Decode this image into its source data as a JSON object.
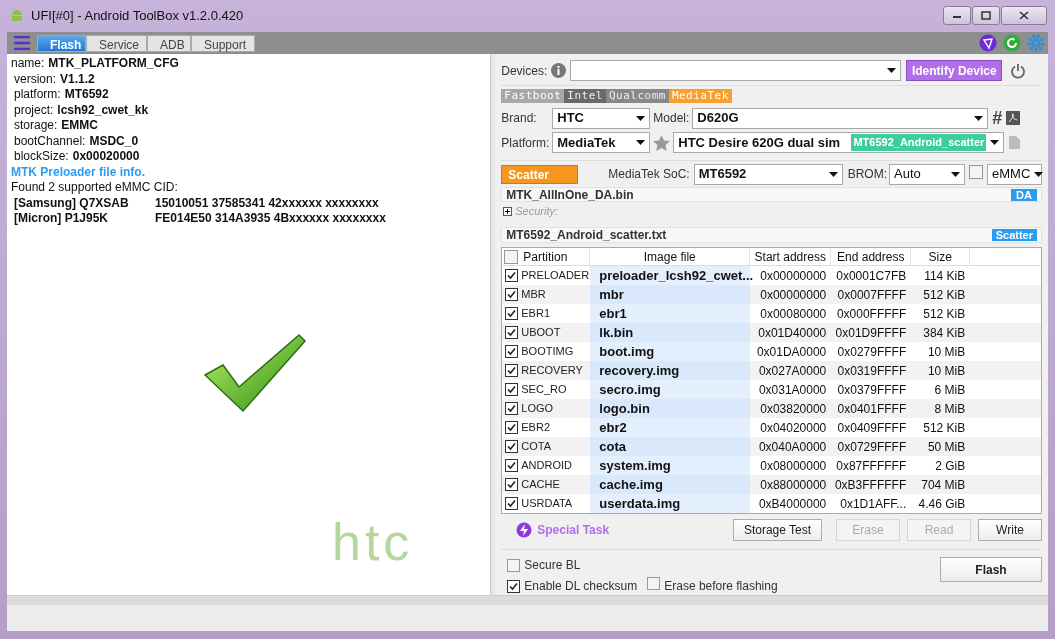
{
  "window": {
    "title": "UFI[#0] - Android ToolBox v1.2.0.420"
  },
  "tabs": [
    {
      "label": "Flash",
      "selected": true
    },
    {
      "label": "Service",
      "selected": false
    },
    {
      "label": "ADB",
      "selected": false
    },
    {
      "label": "Support",
      "selected": false
    }
  ],
  "log": [
    {
      "kind": "field",
      "label": "name:",
      "value": "MTK_PLATFORM_CFG"
    },
    {
      "kind": "subfield",
      "label": "version:",
      "value": "V1.1.2"
    },
    {
      "kind": "subfield",
      "label": "platform:",
      "value": "MT6592"
    },
    {
      "kind": "subfield",
      "label": "project:",
      "value": "lcsh92_cwet_kk"
    },
    {
      "kind": "subfield",
      "label": "storage:",
      "value": "EMMC"
    },
    {
      "kind": "subfield",
      "label": "bootChannel:",
      "value": "MSDC_0"
    },
    {
      "kind": "subfield",
      "label": "blockSize:",
      "value": "0x00020000"
    },
    {
      "kind": "heading",
      "text": "MTK Preloader file info."
    },
    {
      "kind": "plain",
      "text": "Found 2 supported eMMC CID:"
    },
    {
      "kind": "cid",
      "label": "[Samsung] Q7XSAB",
      "value": "15010051 37585341 42xxxxxx xxxxxxxx"
    },
    {
      "kind": "cid",
      "label": "[Micron] P1J95K",
      "value": "FE014E50 314A3935 4Bxxxxxx xxxxxxxx"
    }
  ],
  "brand_logo": "htc",
  "devices": {
    "label": "Devices:",
    "identify_button": "Identify Device"
  },
  "platform_tabs": [
    {
      "label": "Fastboot",
      "selected": false
    },
    {
      "label": "Intel",
      "selected": false
    },
    {
      "label": "Qualcomm",
      "selected": false
    },
    {
      "label": "MediaTek",
      "selected": true
    }
  ],
  "brand": {
    "label": "Brand:",
    "value": "HTC"
  },
  "model": {
    "label": "Model:",
    "value": "D620G",
    "hash_button": "#"
  },
  "platform": {
    "label": "Platform:",
    "value": "MediaTek"
  },
  "device_select": {
    "value": "HTC Desire 620G dual sim",
    "tag": "MT6592_Android_scatter"
  },
  "scatter_button": "Scatter",
  "soc": {
    "label": "MediaTek SoC:",
    "value": "MT6592"
  },
  "brom": {
    "label": "BROM:",
    "value": "Auto",
    "checked": false
  },
  "storage": {
    "value": "eMMC"
  },
  "da_file": {
    "name": "MTK_AllInOne_DA.bin",
    "badge": "DA"
  },
  "security": {
    "label": "Security:",
    "expanded": false
  },
  "scatter_file": {
    "name": "MT6592_Android_scatter.txt",
    "badge": "Scatter"
  },
  "table": {
    "all_checked": false,
    "columns": [
      "Partition",
      "Image file",
      "Start address",
      "End address",
      "Size"
    ],
    "rows": [
      {
        "checked": true,
        "partition": "PRELOADER",
        "file": "preloader_lcsh92_cwet...",
        "start": "0x00000000",
        "end": "0x0001C7FB",
        "size": "114 KiB"
      },
      {
        "checked": true,
        "partition": "MBR",
        "file": "mbr",
        "start": "0x00000000",
        "end": "0x0007FFFF",
        "size": "512 KiB"
      },
      {
        "checked": true,
        "partition": "EBR1",
        "file": "ebr1",
        "start": "0x00080000",
        "end": "0x000FFFFF",
        "size": "512 KiB"
      },
      {
        "checked": true,
        "partition": "UBOOT",
        "file": "lk.bin",
        "start": "0x01D40000",
        "end": "0x01D9FFFF",
        "size": "384 KiB"
      },
      {
        "checked": true,
        "partition": "BOOTIMG",
        "file": "boot.img",
        "start": "0x01DA0000",
        "end": "0x0279FFFF",
        "size": "10 MiB"
      },
      {
        "checked": true,
        "partition": "RECOVERY",
        "file": "recovery.img",
        "start": "0x027A0000",
        "end": "0x0319FFFF",
        "size": "10 MiB"
      },
      {
        "checked": true,
        "partition": "SEC_RO",
        "file": "secro.img",
        "start": "0x031A0000",
        "end": "0x0379FFFF",
        "size": "6 MiB"
      },
      {
        "checked": true,
        "partition": "LOGO",
        "file": "logo.bin",
        "start": "0x03820000",
        "end": "0x0401FFFF",
        "size": "8 MiB"
      },
      {
        "checked": true,
        "partition": "EBR2",
        "file": "ebr2",
        "start": "0x04020000",
        "end": "0x0409FFFF",
        "size": "512 KiB"
      },
      {
        "checked": true,
        "partition": "COTA",
        "file": "cota",
        "start": "0x040A0000",
        "end": "0x0729FFFF",
        "size": "50 MiB"
      },
      {
        "checked": true,
        "partition": "ANDROID",
        "file": "system.img",
        "start": "0x08000000",
        "end": "0x87FFFFFF",
        "size": "2 GiB"
      },
      {
        "checked": true,
        "partition": "CACHE",
        "file": "cache.img",
        "start": "0x88000000",
        "end": "0xB3FFFFFF",
        "size": "704 MiB"
      },
      {
        "checked": true,
        "partition": "USRDATA",
        "file": "userdata.img",
        "start": "0xB4000000",
        "end": "0x1D1AFF...",
        "size": "4.46 GiB"
      }
    ]
  },
  "special_task": "Special Task",
  "actions": [
    {
      "label": "Storage Test",
      "disabled": false
    },
    {
      "label": "Erase",
      "disabled": true
    },
    {
      "label": "Read",
      "disabled": true
    },
    {
      "label": "Write",
      "disabled": false
    }
  ],
  "options": [
    {
      "label": "Secure BL",
      "checked": false
    },
    {
      "label": "Enable DL checksum",
      "checked": true
    },
    {
      "label": "Erase before flashing",
      "checked": false
    }
  ],
  "flash_button": "Flash"
}
